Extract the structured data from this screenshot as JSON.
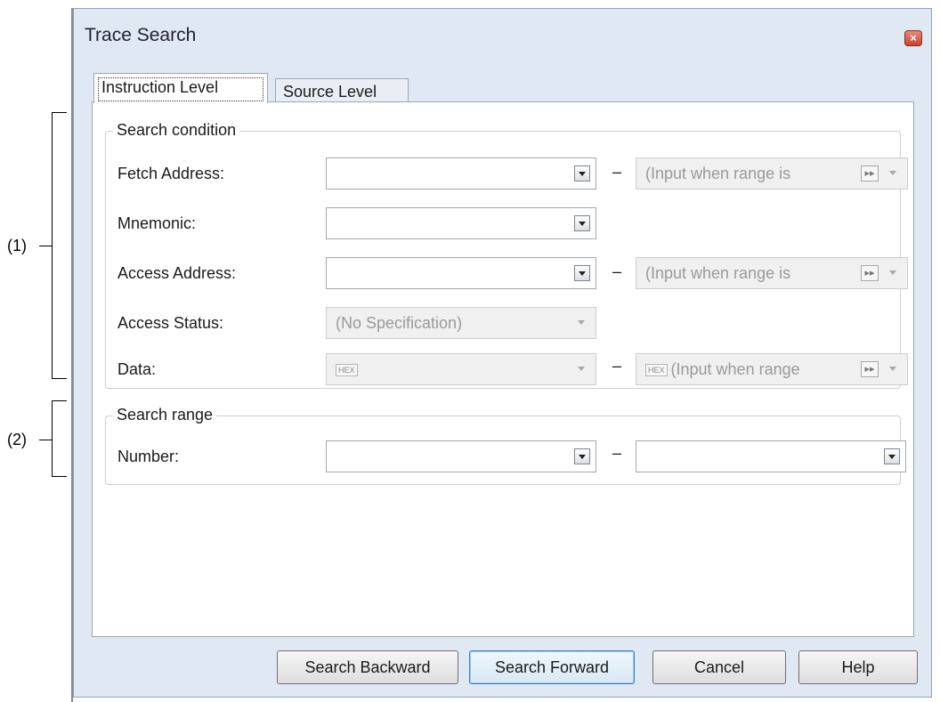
{
  "annotations": {
    "group1": "(1)",
    "group2": "(2)"
  },
  "window": {
    "title": "Trace Search"
  },
  "tabs": [
    {
      "label": "Instruction Level",
      "active": true
    },
    {
      "label": "Source Level",
      "active": false
    }
  ],
  "search_condition": {
    "legend": "Search condition",
    "rows": [
      {
        "label": "Fetch Address:",
        "value": "",
        "range_placeholder": "(Input when range is"
      },
      {
        "label": "Mnemonic:",
        "value": ""
      },
      {
        "label": "Access Address:",
        "value": "",
        "range_placeholder": "(Input when range is"
      },
      {
        "label": "Access Status:",
        "value": "(No Specification)"
      },
      {
        "label": "Data:",
        "value": "",
        "range_placeholder": "(Input when range"
      }
    ],
    "hex_badge": "HEX",
    "range_separator": "–"
  },
  "search_range": {
    "legend": "Search range",
    "number_label": "Number:",
    "from_value": "",
    "to_value": ""
  },
  "buttons": {
    "backward": "Search Backward",
    "forward": "Search Forward",
    "cancel": "Cancel",
    "help": "Help"
  },
  "colors": {
    "window_bg": "#dfe8f3",
    "accent": "#3c7fb1"
  }
}
